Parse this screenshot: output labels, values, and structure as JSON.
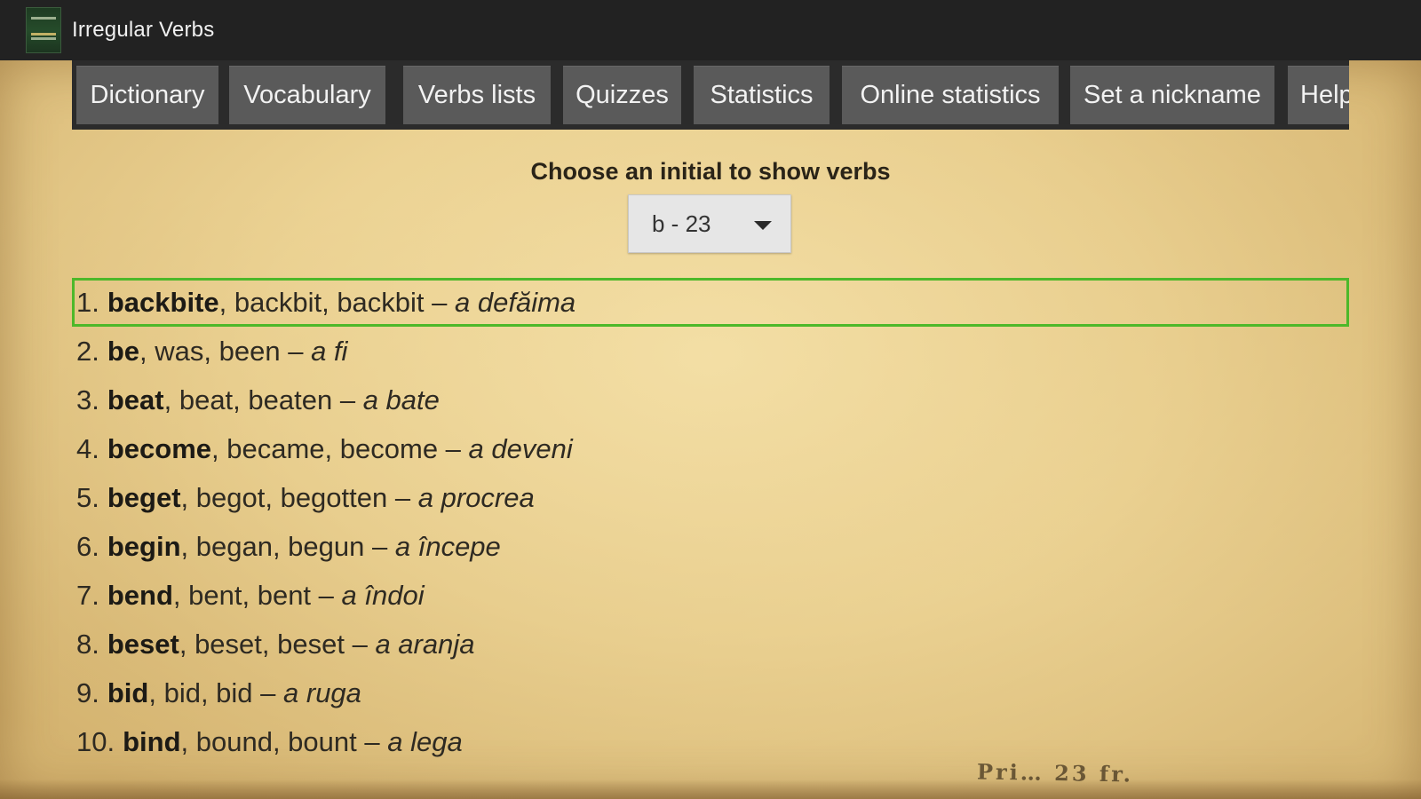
{
  "app": {
    "title": "Irregular Verbs",
    "icon": "book-icon"
  },
  "tabs": [
    {
      "label": "Dictionary"
    },
    {
      "label": "Vocabulary"
    },
    {
      "label": "Verbs lists"
    },
    {
      "label": "Quizzes"
    },
    {
      "label": "Statistics"
    },
    {
      "label": "Online statistics"
    },
    {
      "label": "Set a nickname"
    },
    {
      "label": "Help"
    }
  ],
  "selector": {
    "label": "Choose an initial to show verbs",
    "value": "b - 23"
  },
  "verbs": [
    {
      "num": "1.",
      "base": "backbite",
      "rest": ", backbit, backbit – ",
      "translation": "a defăima",
      "selected": true
    },
    {
      "num": "2.",
      "base": "be",
      "rest": ", was, been – ",
      "translation": "a fi"
    },
    {
      "num": "3.",
      "base": "beat",
      "rest": ", beat, beaten – ",
      "translation": "a bate"
    },
    {
      "num": "4.",
      "base": "become",
      "rest": ", became, become – ",
      "translation": "a deveni"
    },
    {
      "num": "5.",
      "base": "beget",
      "rest": ", begot, begotten – ",
      "translation": "a procrea"
    },
    {
      "num": "6.",
      "base": "begin",
      "rest": ", began, begun – ",
      "translation": "a începe"
    },
    {
      "num": "7.",
      "base": "bend",
      "rest": ", bent, bent – ",
      "translation": "a îndoi"
    },
    {
      "num": "8.",
      "base": "beset",
      "rest": ", beset, beset – ",
      "translation": "a aranja"
    },
    {
      "num": "9.",
      "base": "bid",
      "rest": ", bid, bid – ",
      "translation": "a ruga"
    },
    {
      "num": "10.",
      "base": "bind",
      "rest": ", bound, bount – ",
      "translation": "a lega"
    }
  ],
  "background": {
    "stamp_text": "Pri… 23 fr."
  },
  "colors": {
    "titlebar": "#222222",
    "tab_bg": "#5a5a5a",
    "tabbar_bg": "#2b2b2b",
    "selection_border": "#4db82a",
    "paper": "#e8cd8f"
  }
}
